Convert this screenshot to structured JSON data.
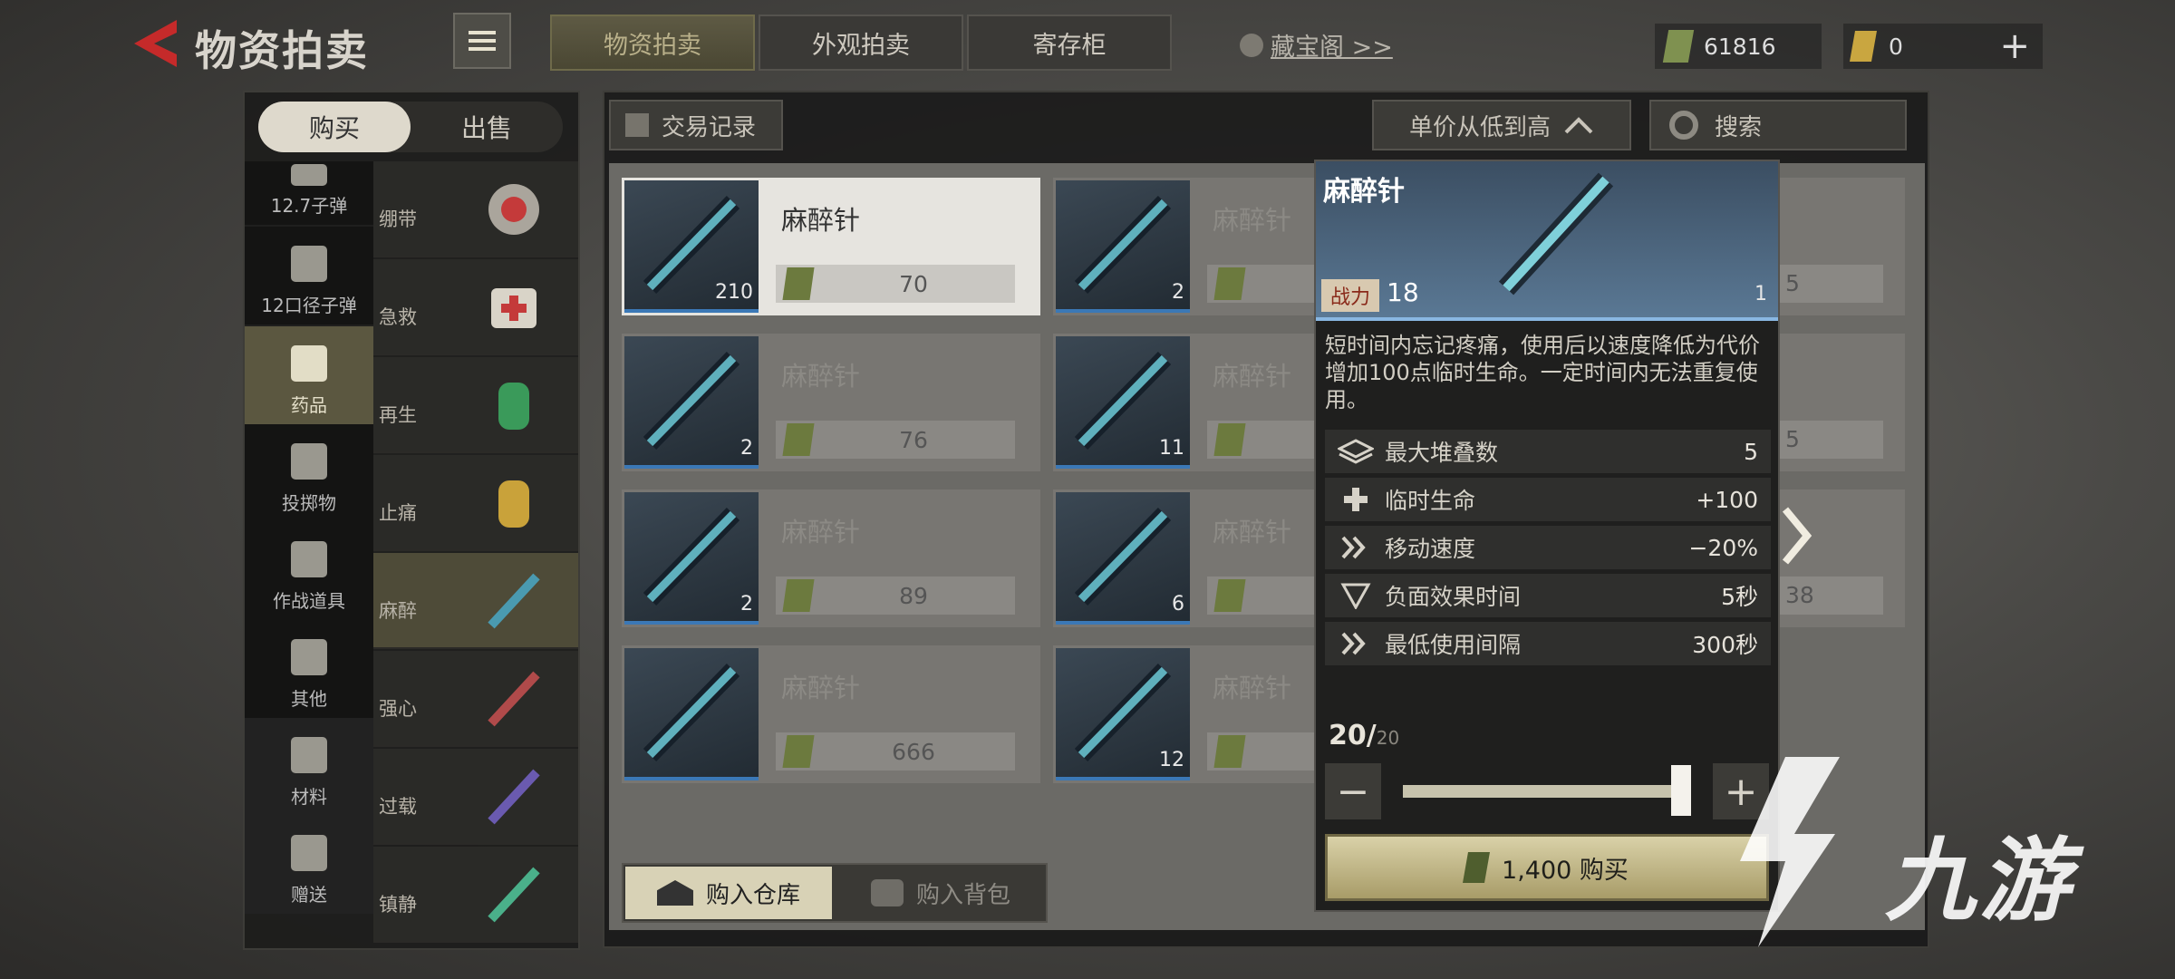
{
  "header": {
    "title": "物资拍卖",
    "tabs": [
      "物资拍卖",
      "外观拍卖",
      "寄存柜"
    ],
    "active_tab": 0,
    "treasure_link": "藏宝阁 >>",
    "currency_cash": "61816",
    "currency_gold": "0"
  },
  "sidebar": {
    "segments": [
      "购买",
      "出售"
    ],
    "categories": [
      {
        "label": "12.7子弹"
      },
      {
        "label": "12口径子弹"
      },
      {
        "label": "药品"
      },
      {
        "label": "投掷物"
      },
      {
        "label": "作战道具"
      },
      {
        "label": "其他"
      },
      {
        "label": "材料"
      },
      {
        "label": "赠送"
      }
    ],
    "subcategories": [
      {
        "label": "绷带"
      },
      {
        "label": "急救"
      },
      {
        "label": "再生"
      },
      {
        "label": "止痛"
      },
      {
        "label": "麻醉"
      },
      {
        "label": "强心"
      },
      {
        "label": "过载"
      },
      {
        "label": "镇静"
      }
    ]
  },
  "toolbar": {
    "trade_record": "交易记录",
    "sort": "单价从低到高",
    "search": "搜索"
  },
  "listings": [
    {
      "name": "麻醉针",
      "count": "210",
      "price": "70"
    },
    {
      "name": "麻醉针",
      "count": "2",
      "price": ""
    },
    {
      "name": "麻醉针",
      "count": "2",
      "price": "76"
    },
    {
      "name": "麻醉针",
      "count": "11",
      "price": ""
    },
    {
      "name": "麻醉针",
      "count": "2",
      "price": "89"
    },
    {
      "name": "麻醉针",
      "count": "6",
      "price": ""
    },
    {
      "name": "麻醉针",
      "count": "",
      "price": "666"
    },
    {
      "name": "麻醉针",
      "count": "12",
      "price": ""
    }
  ],
  "partial_prices": [
    "5",
    "5",
    "38"
  ],
  "bottom": {
    "to_warehouse": "购入仓库",
    "to_backpack": "购入背包"
  },
  "detail": {
    "name": "麻醉针",
    "power_label": "战力",
    "power_value": "18",
    "count": "1",
    "description": "短时间内忘记疼痛，使用后以速度降低为代价增加100点临时生命。一定时间内无法重复使用。",
    "stats": [
      {
        "icon": "layers-icon",
        "label": "最大堆叠数",
        "value": "5"
      },
      {
        "icon": "plus-icon",
        "label": "临时生命",
        "value": "+100"
      },
      {
        "icon": "speed-icon",
        "label": "移动速度",
        "value": "−20%"
      },
      {
        "icon": "debuff-icon",
        "label": "负面效果时间",
        "value": "5秒"
      },
      {
        "icon": "speed-icon",
        "label": "最低使用间隔",
        "value": "300秒"
      }
    ],
    "quantity": "20/",
    "quantity_max": "20",
    "slider_fraction": 1.0,
    "buy_label": "1,400 购买"
  },
  "watermark": "九游"
}
